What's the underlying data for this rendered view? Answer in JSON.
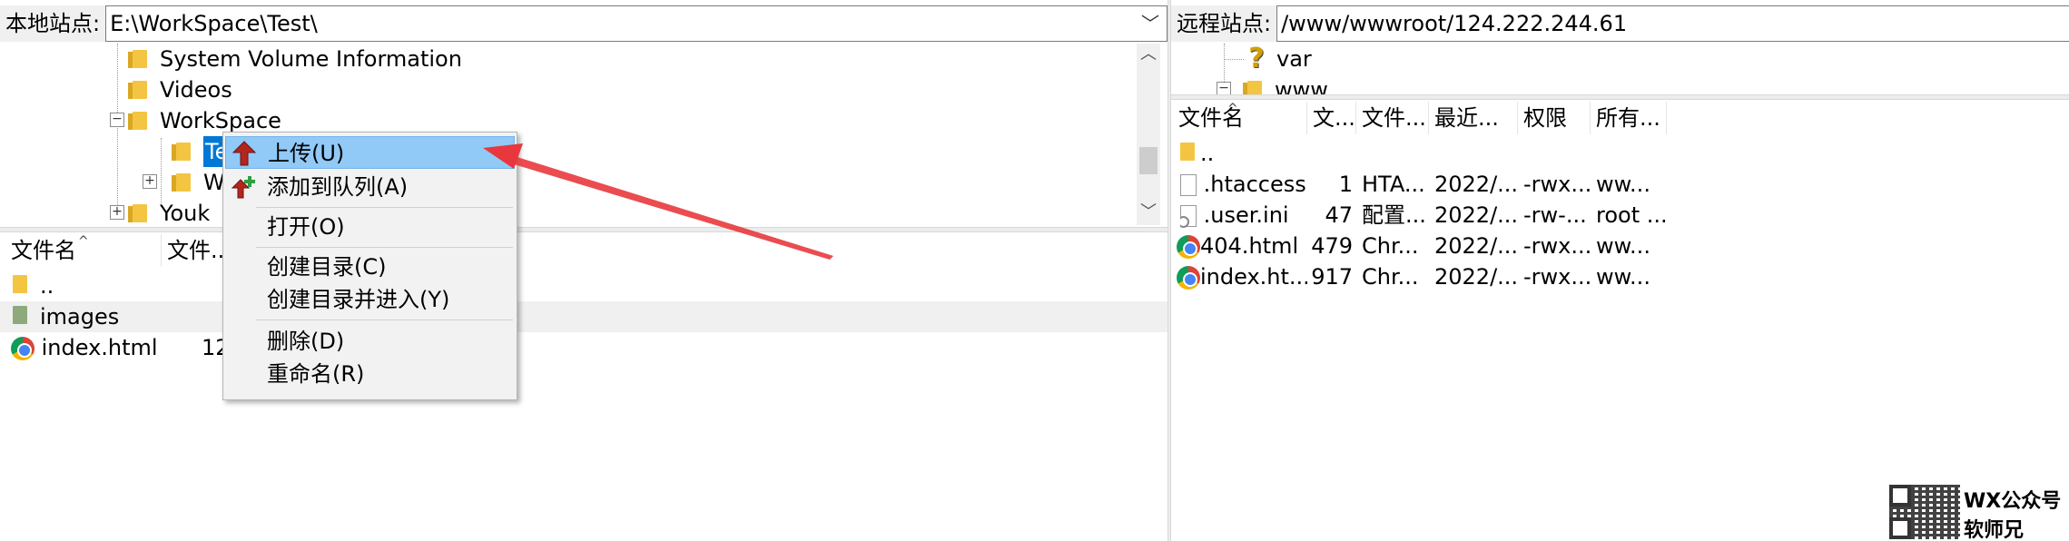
{
  "left": {
    "addr_label": "本地站点:",
    "addr_value": "E:\\WorkSpace\\Test\\",
    "tree": [
      {
        "label": "System Volume Information"
      },
      {
        "label": "Videos"
      },
      {
        "label": "WorkSpace"
      },
      {
        "label": "Te"
      },
      {
        "label": "W"
      },
      {
        "label": "Youk"
      }
    ],
    "list_headers": [
      "文件名",
      "文件..."
    ],
    "files": [
      {
        "name": "..",
        "size": ""
      },
      {
        "name": "images",
        "size": ""
      },
      {
        "name": "index.html",
        "size": "12"
      }
    ]
  },
  "right": {
    "addr_label": "远程站点:",
    "addr_value": "/www/wwwroot/124.222.244.61",
    "tree": [
      {
        "label": "var"
      },
      {
        "label": "www"
      }
    ],
    "list_headers": [
      "文件名",
      "文...",
      "文件...",
      "最近...",
      "权限",
      "所有..."
    ],
    "files": [
      {
        "name": "..",
        "size": "",
        "type": "",
        "modified": "",
        "perms": "",
        "owner": ""
      },
      {
        "name": ".htaccess",
        "size": "1",
        "type": "HTA...",
        "modified": "2022/...",
        "perms": "-rwx...",
        "owner": "ww..."
      },
      {
        "name": ".user.ini",
        "size": "47",
        "type": "配置...",
        "modified": "2022/...",
        "perms": "-rw-...",
        "owner": "root ..."
      },
      {
        "name": "404.html",
        "size": "479",
        "type": "Chr...",
        "modified": "2022/...",
        "perms": "-rwx...",
        "owner": "ww..."
      },
      {
        "name": "index.ht...",
        "size": "917",
        "type": "Chr...",
        "modified": "2022/...",
        "perms": "-rwx...",
        "owner": "ww..."
      }
    ]
  },
  "context_menu": {
    "items": [
      {
        "label": "上传(U)"
      },
      {
        "label": "添加到队列(A)"
      },
      {
        "label": "打开(O)"
      },
      {
        "label": "创建目录(C)"
      },
      {
        "label": "创建目录并进入(Y)"
      },
      {
        "label": "删除(D)"
      },
      {
        "label": "重命名(R)"
      }
    ]
  },
  "watermark": {
    "line1": "WX公众号",
    "line2": "软师兄"
  },
  "colors": {
    "highlight": "#91c9f7",
    "selection": "#0078d7",
    "arrow": "#e8383d"
  },
  "icons": {
    "upload": "upload-arrow-icon",
    "queue": "add-to-queue-icon",
    "folder": "folder-icon",
    "chrome": "chrome-icon"
  }
}
